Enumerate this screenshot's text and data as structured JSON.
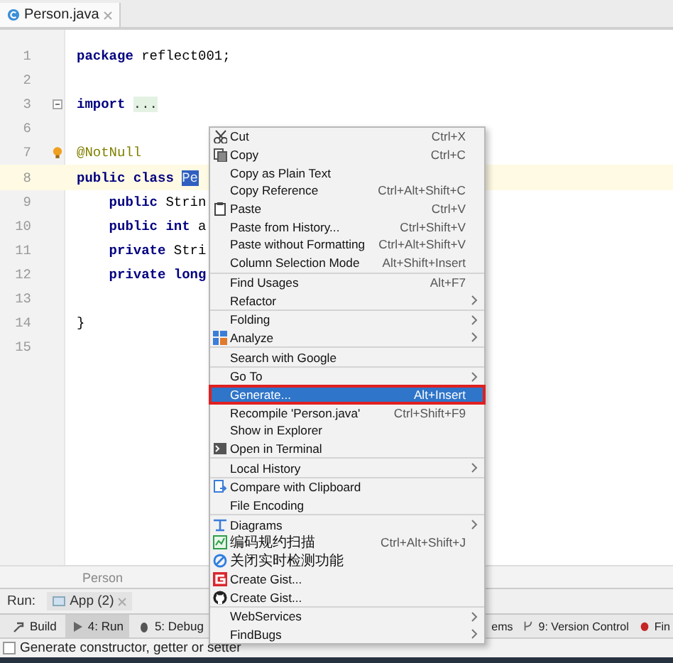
{
  "editor_tab": {
    "label": "Person.java",
    "selected": true
  },
  "code_lines": [
    {
      "number": "1",
      "current": false,
      "tokens": [
        {
          "kind": "keyword",
          "text": "package"
        },
        {
          "kind": "plain",
          "text": "reflect001;"
        }
      ]
    },
    {
      "number": "2",
      "current": false
    },
    {
      "number": "3",
      "current": false,
      "tokens": [
        {
          "kind": "keyword",
          "text": "import"
        },
        {
          "kind": "folded",
          "text": "..."
        }
      ]
    },
    {
      "number": "6",
      "current": false
    },
    {
      "number": "7",
      "current": false,
      "tokens": [
        {
          "kind": "annotation",
          "text": "@NotNull"
        }
      ]
    },
    {
      "number": "8",
      "current": true,
      "tokens": [
        {
          "kind": "keyword",
          "text": "public"
        },
        {
          "kind": "keyword",
          "text": "class"
        },
        {
          "kind": "selected",
          "text": "Pe"
        }
      ],
      "children": [
        {
          "number": "9",
          "current": false,
          "tokens": [
            {
              "kind": "keyword",
              "text": "public"
            },
            {
              "kind": "plain",
              "text": "Strin"
            }
          ]
        },
        {
          "number": "10",
          "current": false,
          "tokens": [
            {
              "kind": "keyword",
              "text": "public"
            },
            {
              "kind": "keyword",
              "text": "int"
            },
            {
              "kind": "plain",
              "text": "a"
            }
          ]
        },
        {
          "number": "11",
          "current": false,
          "tokens": [
            {
              "kind": "keyword",
              "text": "private"
            },
            {
              "kind": "plain",
              "text": "Stri"
            }
          ]
        },
        {
          "number": "12",
          "current": false,
          "tokens": [
            {
              "kind": "keyword",
              "text": "private"
            },
            {
              "kind": "keyword",
              "text": "long"
            }
          ]
        }
      ]
    },
    {
      "number": "13",
      "current": false
    },
    {
      "number": "14",
      "current": false,
      "tokens": [
        {
          "kind": "plain",
          "text": "}"
        }
      ]
    },
    {
      "number": "15",
      "current": false
    }
  ],
  "context_menu": {
    "groups": [
      {
        "items": [
          {
            "label": "Cut",
            "shortcut": "Ctrl+X",
            "submenu": false,
            "selected": false
          },
          {
            "label": "Copy",
            "shortcut": "Ctrl+C",
            "submenu": false,
            "selected": false
          },
          {
            "label": "Copy as Plain Text",
            "submenu": false,
            "selected": false
          },
          {
            "label": "Copy Reference",
            "shortcut": "Ctrl+Alt+Shift+C",
            "submenu": false,
            "selected": false
          },
          {
            "label": "Paste",
            "shortcut": "Ctrl+V",
            "submenu": false,
            "selected": false
          },
          {
            "label": "Paste from History...",
            "shortcut": "Ctrl+Shift+V",
            "submenu": false,
            "selected": false
          },
          {
            "label": "Paste without Formatting",
            "shortcut": "Ctrl+Alt+Shift+V",
            "submenu": false,
            "selected": false
          },
          {
            "label": "Column Selection Mode",
            "shortcut": "Alt+Shift+Insert",
            "submenu": false,
            "selected": false
          }
        ]
      },
      {
        "items": [
          {
            "label": "Find Usages",
            "shortcut": "Alt+F7",
            "submenu": false,
            "selected": false
          },
          {
            "label": "Refactor",
            "submenu": true,
            "selected": false
          }
        ]
      },
      {
        "items": [
          {
            "label": "Folding",
            "submenu": true,
            "selected": false
          },
          {
            "label": "Analyze",
            "submenu": true,
            "selected": false
          }
        ]
      },
      {
        "items": [
          {
            "label": "Search with Google",
            "submenu": false,
            "selected": false
          }
        ]
      },
      {
        "items": [
          {
            "label": "Go To",
            "submenu": true,
            "selected": false
          },
          {
            "label": "Generate...",
            "shortcut": "Alt+Insert",
            "submenu": false,
            "selected": true
          },
          {
            "label": "Recompile 'Person.java'",
            "shortcut": "Ctrl+Shift+F9",
            "submenu": false,
            "selected": false
          },
          {
            "label": "Show in Explorer",
            "submenu": false,
            "selected": false
          },
          {
            "label": "Open in Terminal",
            "submenu": false,
            "selected": false
          }
        ]
      },
      {
        "items": [
          {
            "label": "Local History",
            "submenu": true,
            "selected": false
          }
        ]
      },
      {
        "items": [
          {
            "label": "Compare with Clipboard",
            "submenu": false,
            "selected": false
          },
          {
            "label": "File Encoding",
            "submenu": false,
            "selected": false
          }
        ]
      },
      {
        "items": [
          {
            "label": "Diagrams",
            "submenu": true,
            "selected": false
          },
          {
            "label": "编码规约扫描",
            "shortcut": "Ctrl+Alt+Shift+J",
            "submenu": false,
            "selected": false
          },
          {
            "label": "关闭实时检测功能",
            "submenu": false,
            "selected": false
          },
          {
            "label": "Create Gist...",
            "submenu": false,
            "selected": false
          },
          {
            "label": "Create Gist...",
            "submenu": false,
            "selected": false
          }
        ]
      },
      {
        "items": [
          {
            "label": "WebServices",
            "submenu": true,
            "selected": false
          },
          {
            "label": "FindBugs",
            "submenu": true,
            "selected": false
          }
        ]
      }
    ]
  },
  "breadcrumb": "Person",
  "run_bar": {
    "label": "Run:",
    "tab": "App (2)"
  },
  "tool_tabs_left": [
    {
      "label": "Build",
      "selected": false
    },
    {
      "label": "4: Run",
      "selected": true
    },
    {
      "label": "5: Debug",
      "selected": false
    }
  ],
  "tool_tabs_right": [
    {
      "label": "ems",
      "selected": false
    },
    {
      "label": "9: Version Control",
      "selected": false
    },
    {
      "label": "Fin",
      "selected": false
    }
  ],
  "status_bar": "Generate constructor, getter or setter"
}
